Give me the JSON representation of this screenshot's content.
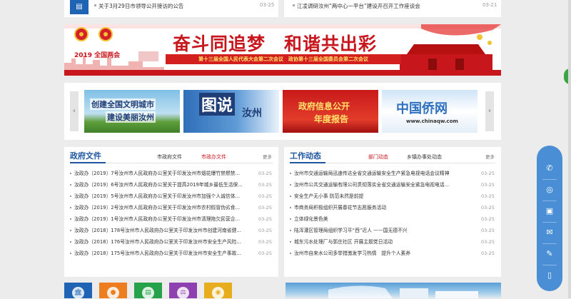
{
  "top_news": {
    "left": {
      "title": "关于3月29日市领导公开接访的公告",
      "date": "03-25"
    },
    "right": {
      "title": "江凌调研汝州“两中心一平台”建设开召开工作座谈会",
      "date": "03-21"
    }
  },
  "banner": {
    "year_label": "2019 全国两会",
    "slogan": "奋斗同追梦　和谐共出彩",
    "subline": "第十三届全国人民代表大会第二次会议　政协第十三届全国委员会第二次会议",
    "colors": {
      "red": "#c8161d",
      "gold": "#ffe26a"
    }
  },
  "slider": {
    "prev_icon": "chevron-left-icon",
    "next_icon": "chevron-right-icon",
    "tiles": [
      {
        "line1": "创建全国文明城市",
        "line2": "建设美丽汝州"
      },
      {
        "line1": "图说",
        "line2": "汝州"
      },
      {
        "line1": "政府信息公开",
        "line2": "年度报告"
      },
      {
        "line1": "中国侨网",
        "line2": "www.chinaqw.com"
      }
    ]
  },
  "gov_docs": {
    "title": "政府文件",
    "tabs": [
      "市政府文件",
      "市政办文件"
    ],
    "active_tab": 1,
    "more": "更多",
    "items": [
      {
        "title": "汝政办〔2019〕7号汝州市人民政府办公室关于印发汝州市烟花爆竹禁燃禁...",
        "date": "03-25"
      },
      {
        "title": "汝政办〔2019〕6号汝州市人民政府办公室关于提高2019年城乡最低生活保...",
        "date": "03-25"
      },
      {
        "title": "汝政办〔2019〕5号汝州市人民政府办公室关于印发汝州市加强个人诚信体...",
        "date": "03-25"
      },
      {
        "title": "汝政办〔2019〕2号汝州市人民政府办公室关于印发汝州市农村假冒伪劣食...",
        "date": "03-25"
      },
      {
        "title": "汝政办〔2019〕1号汝州市人民政府办公室关于印发汝州市清理拖欠民营企...",
        "date": "03-25"
      },
      {
        "title": "汝政办〔2018〕178号汝州市人民政府办公室关于印发汝州市创建河南省健...",
        "date": "03-25"
      },
      {
        "title": "汝政办〔2018〕176号汝州市人民政府办公室关于印发汝州市安全生产风险...",
        "date": "03-25"
      },
      {
        "title": "汝政办〔2018〕175号汝州市人民政府办公室关于印发汝州市安全生产事故...",
        "date": "03-25"
      }
    ]
  },
  "work_news": {
    "title": "工作动态",
    "tabs": [
      "部门动态",
      "乡镇办事处动态"
    ],
    "active_tab": 0,
    "more": "更多",
    "items": [
      {
        "title": "汝州市交通运输局迅速传达全省交通运输安全生产紧急电视电话会议精神",
        "date": "03-25"
      },
      {
        "title": "汝州市公共交通运输有限公司贯彻落实全省交通运输安全紧急电视电话...",
        "date": "03-25"
      },
      {
        "title": "安全生产无小事 防范未然是前提",
        "date": "03-25"
      },
      {
        "title": "市商务局积极组织开展春花节志愿服务活动",
        "date": "03-25"
      },
      {
        "title": "立体绿化景色美",
        "date": "03-25"
      },
      {
        "title": "陆浑灌区管理局组织学习平“西”近人 ——国无德不兴",
        "date": "03-25"
      },
      {
        "title": "城东污水处理厂与郭庄社区 开展主题党日活动",
        "date": "03-25"
      },
      {
        "title": "汝州市自来水公司多举措激发学习热情　提升个人素养",
        "date": "03-25"
      }
    ]
  },
  "bottom_icons": [
    {
      "icon": "building-icon",
      "color": "#1e63b4"
    },
    {
      "icon": "person-icon",
      "color": "#ee7d1f"
    },
    {
      "icon": "document-icon",
      "color": "#27a24a"
    },
    {
      "icon": "scales-icon",
      "color": "#8e3fb0"
    },
    {
      "icon": "film-icon",
      "color": "#e8ac1f"
    }
  ],
  "toolbar": {
    "items": [
      "wechat-icon",
      "weibo-icon",
      "app-icon",
      "mail-icon",
      "edit-icon",
      "mobile-icon"
    ],
    "color": "#4a8fd6"
  }
}
